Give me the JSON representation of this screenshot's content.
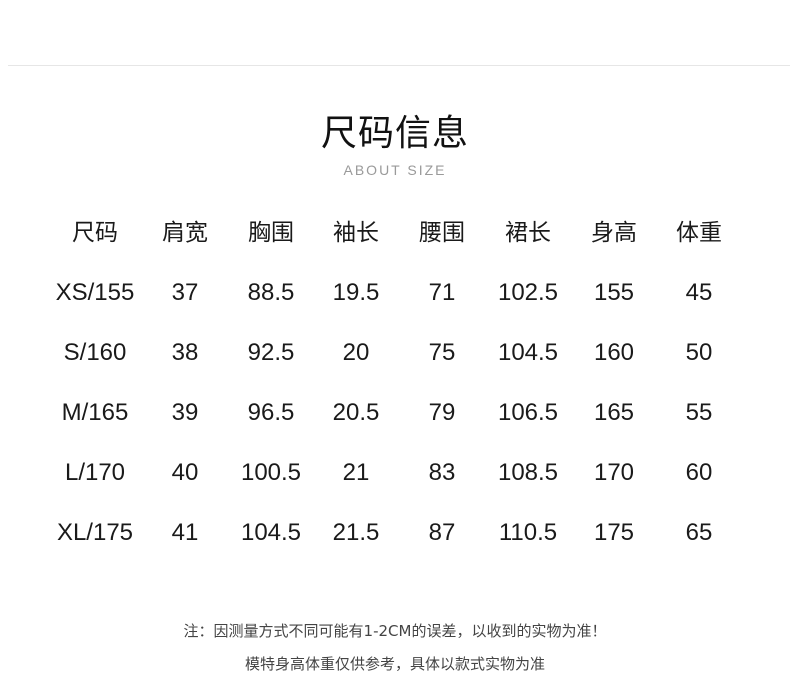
{
  "header": {
    "title": "尺码信息",
    "subtitle": "ABOUT SIZE"
  },
  "table": {
    "columns": [
      "尺码",
      "肩宽",
      "胸围",
      "袖长",
      "腰围",
      "裙长",
      "身高",
      "体重"
    ],
    "rows": [
      [
        "XS/155",
        "37",
        "88.5",
        "19.5",
        "71",
        "102.5",
        "155",
        "45"
      ],
      [
        "S/160",
        "38",
        "92.5",
        "20",
        "75",
        "104.5",
        "160",
        "50"
      ],
      [
        "M/165",
        "39",
        "96.5",
        "20.5",
        "79",
        "106.5",
        "165",
        "55"
      ],
      [
        "L/170",
        "40",
        "100.5",
        "21",
        "83",
        "108.5",
        "170",
        "60"
      ],
      [
        "XL/175",
        "41",
        "104.5",
        "21.5",
        "87",
        "110.5",
        "175",
        "65"
      ]
    ]
  },
  "notes": {
    "line1": "注：因测量方式不同可能有1-2CM的误差，以收到的实物为准！",
    "line2": "模特身高体重仅供参考，具体以款式实物为准"
  },
  "colors": {
    "text": "#1a1a1a",
    "subtitle": "#9a9a9a",
    "note": "#444444",
    "rule": "#e6e6e6",
    "background": "#ffffff"
  }
}
